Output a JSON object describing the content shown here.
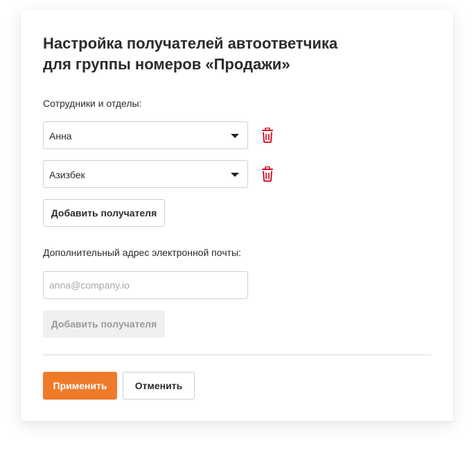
{
  "dialog": {
    "title_line1": "Настройка получателей автоответчика",
    "title_line2": "для группы номеров «Продажи»"
  },
  "recipients": {
    "label": "Сотрудники и отделы:",
    "items": [
      {
        "value": "Анна",
        "delete_icon": "trash-icon"
      },
      {
        "value": "Азизбек",
        "delete_icon": "trash-icon"
      }
    ],
    "add_button_label": "Добавить получателя"
  },
  "email": {
    "label": "Дополнительный адрес электронной почты:",
    "value": "",
    "placeholder": "anna@company.io",
    "add_button_label": "Добавить получателя",
    "add_button_disabled": true
  },
  "actions": {
    "apply_label": "Применить",
    "cancel_label": "Отменить"
  },
  "colors": {
    "accent": "#ef7a2a",
    "danger": "#d0021b",
    "text": "#2b2b2b",
    "border": "#cfcfcf"
  }
}
